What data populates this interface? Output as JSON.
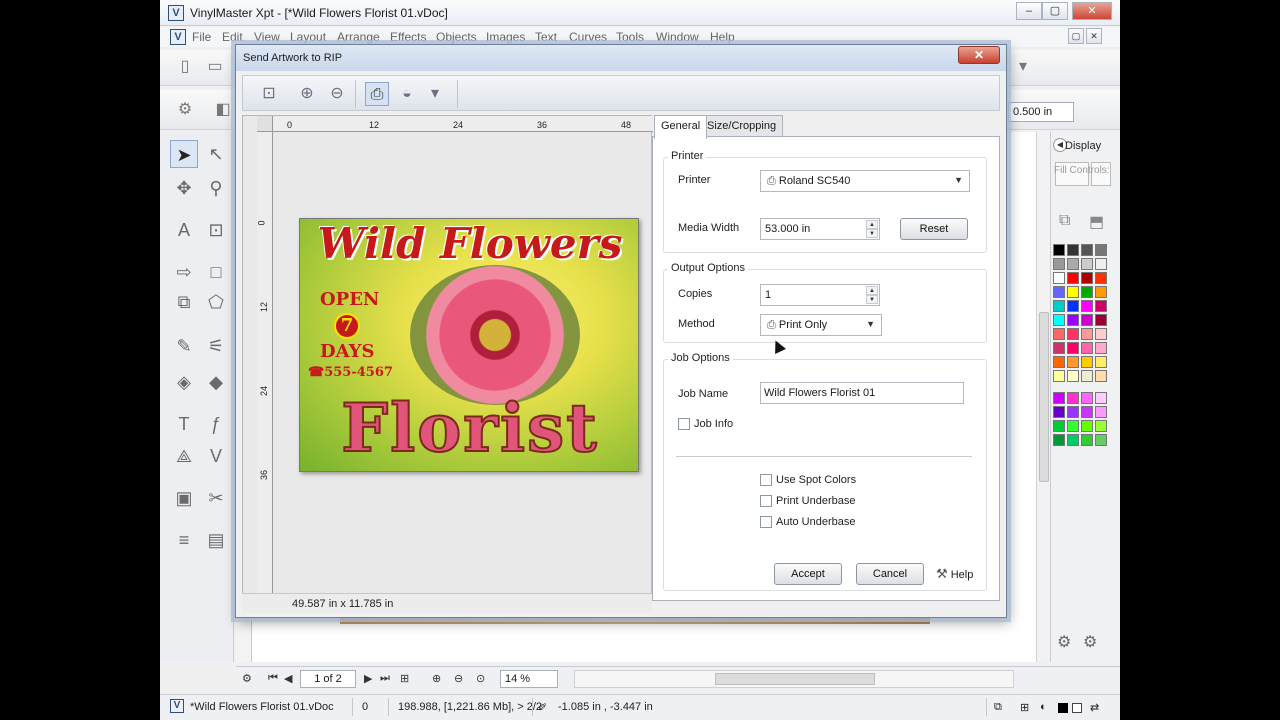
{
  "window": {
    "title": "VinylMaster Xpt - [*Wild Flowers Florist 01.vDoc]",
    "app_icon": "V"
  },
  "menu": [
    "File",
    "Edit",
    "View",
    "Layout",
    "Arrange",
    "Effects",
    "Objects",
    "Images",
    "Text",
    "Curves",
    "Tools",
    "Window",
    "Help"
  ],
  "toolbar": {
    "size_value": "0.500 in"
  },
  "docker": {
    "display_label": "Display",
    "fill_controls_label": "Fill Controls:"
  },
  "nav": {
    "page_value": "1 of 2",
    "zoom_value": "14 %"
  },
  "status": {
    "doc_name": "*Wild Flowers Florist 01.vDoc",
    "selection_count": "0",
    "memory": "198.988, [1,221.86 Mb], > 2/2",
    "coords": "-1.085 in , -3.447 in"
  },
  "dialog": {
    "title": "Send Artwork to RIP",
    "close_label": "✕",
    "ruler_h": [
      "0",
      "12",
      "24",
      "36",
      "48"
    ],
    "ruler_v": [
      "0",
      "12",
      "24",
      "36"
    ],
    "artwork": {
      "title": "Wild Flowers",
      "open": "OPEN",
      "seven": "7",
      "days": "DAYS",
      "phone": "☎555-4567",
      "florist": "Florist"
    },
    "preview_size": "49.587 in x 11.785 in",
    "tabs": [
      "General",
      "Size/Cropping"
    ],
    "printer_group": {
      "label": "Printer",
      "printer_label": "Printer",
      "printer_value": "Roland SC540",
      "media_width_label": "Media Width",
      "media_width_value": "53.000 in",
      "reset_label": "Reset"
    },
    "output_group": {
      "label": "Output Options",
      "copies_label": "Copies",
      "copies_value": "1",
      "method_label": "Method",
      "method_value": "Print Only"
    },
    "job_group": {
      "label": "Job Options",
      "job_name_label": "Job Name",
      "job_name_value": "Wild Flowers Florist 01",
      "job_info_label": "Job Info",
      "use_spot_colors_label": "Use Spot Colors",
      "print_underbase_label": "Print Underbase",
      "auto_underbase_label": "Auto Underbase"
    },
    "buttons": {
      "accept": "Accept",
      "cancel": "Cancel",
      "help": "Help"
    }
  },
  "palette_colors": [
    "#000000",
    "#333333",
    "#555555",
    "#777777",
    "#999999",
    "#aaaaaa",
    "#cccccc",
    "#eeeeee",
    "#ffffff",
    "#ff0000",
    "#aa0000",
    "#ff3300",
    "#6666ff",
    "#ffff00",
    "#00aa00",
    "#ff9900",
    "#00cccc",
    "#0033ff",
    "#ff00ff",
    "#cc0066",
    "#00ffff",
    "#9900ff",
    "#cc00cc",
    "#990033",
    "#ff6666",
    "#ff3366",
    "#ff9999",
    "#ffcccc",
    "#cc3366",
    "#ff0066",
    "#ff66aa",
    "#ffaacc",
    "#ff6600",
    "#ff9933",
    "#ffcc00",
    "#ffee66",
    "#ffff99",
    "#ffffcc",
    "#eeeecc",
    "#ffddaa",
    "#cc00ff",
    "#ff33cc",
    "#ff66ff",
    "#ffccff",
    "#6600cc",
    "#9933ff",
    "#cc33ff",
    "#ff99ff",
    "#00cc33",
    "#33ff33",
    "#66ff00",
    "#99ff33",
    "#009933",
    "#00cc66",
    "#33cc33",
    "#66cc66"
  ]
}
